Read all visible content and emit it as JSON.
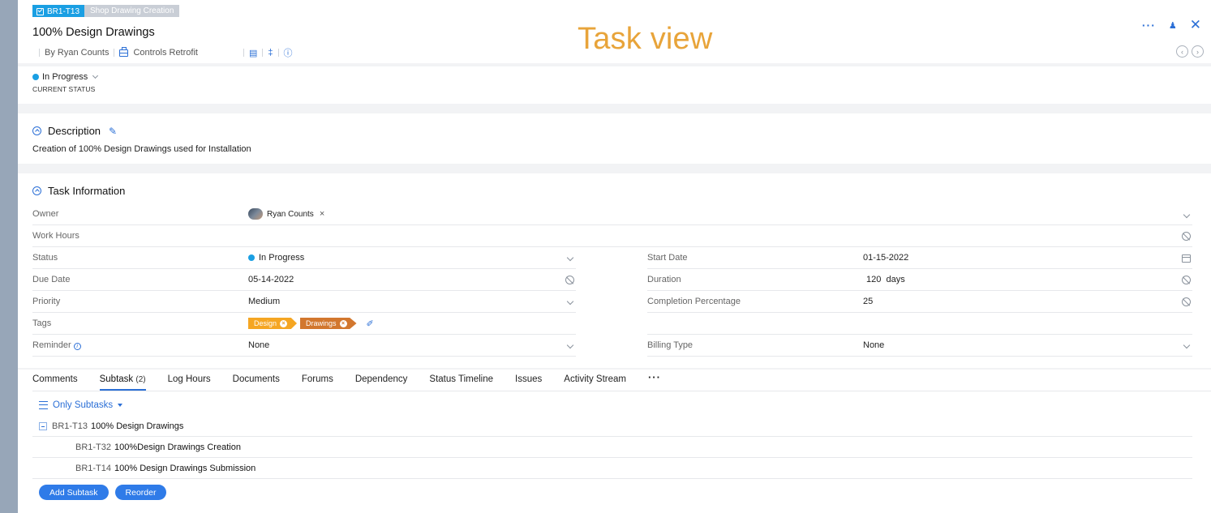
{
  "header": {
    "task_id": "BR1-T13",
    "breadcrumb_label": "Shop Drawing Creation",
    "title": "100% Design Drawings",
    "by_label": "By Ryan Counts",
    "project": "Controls Retrofit",
    "overlay_title": "Task view",
    "icons": [
      "check-box-icon",
      "briefcase-icon",
      "comment-icon",
      "attachment-icon",
      "info-icon",
      "more-icon",
      "person-share-icon",
      "close-icon",
      "prev-icon",
      "next-icon"
    ]
  },
  "status": {
    "value": "In Progress",
    "caption": "CURRENT STATUS",
    "color": "#1a9fe3"
  },
  "description": {
    "heading": "Description",
    "text": "Creation of 100% Design Drawings used for Installation"
  },
  "task_info": {
    "heading": "Task Information",
    "owner": {
      "label": "Owner",
      "value": "Ryan Counts"
    },
    "work_hours": {
      "label": "Work Hours"
    },
    "status": {
      "label": "Status",
      "value": "In Progress"
    },
    "start_date": {
      "label": "Start Date",
      "value": "01-15-2022"
    },
    "due_date": {
      "label": "Due Date",
      "value": "05-14-2022"
    },
    "duration": {
      "label": "Duration",
      "value": "120  days"
    },
    "priority": {
      "label": "Priority",
      "value": "Medium"
    },
    "completion": {
      "label": "Completion Percentage",
      "value": "25"
    },
    "tags": {
      "label": "Tags",
      "items": [
        "Design",
        "Drawings"
      ]
    },
    "reminder": {
      "label": "Reminder",
      "value": "None"
    },
    "billing_type": {
      "label": "Billing Type",
      "value": "None"
    }
  },
  "tabs": {
    "items": [
      "Comments",
      "Subtask",
      "Log Hours",
      "Documents",
      "Forums",
      "Dependency",
      "Status Timeline",
      "Issues",
      "Activity Stream"
    ],
    "subtask_count": "(2)",
    "active": "Subtask"
  },
  "subtasks": {
    "filter": "Only Subtasks",
    "parent": {
      "id": "BR1-T13",
      "name": "100% Design Drawings"
    },
    "children": [
      {
        "id": "BR1-T32",
        "name": "100%Design Drawings Creation"
      },
      {
        "id": "BR1-T14",
        "name": "100% Design Drawings Submission"
      }
    ],
    "add_button": "Add Subtask",
    "reorder_button": "Reorder"
  },
  "colors": {
    "accent": "#2b6fd6",
    "status_dot": "#1a9fe3",
    "tag_design": "#f5a623",
    "tag_drawings": "#d2772e",
    "overlay_text": "#e8a43a"
  }
}
